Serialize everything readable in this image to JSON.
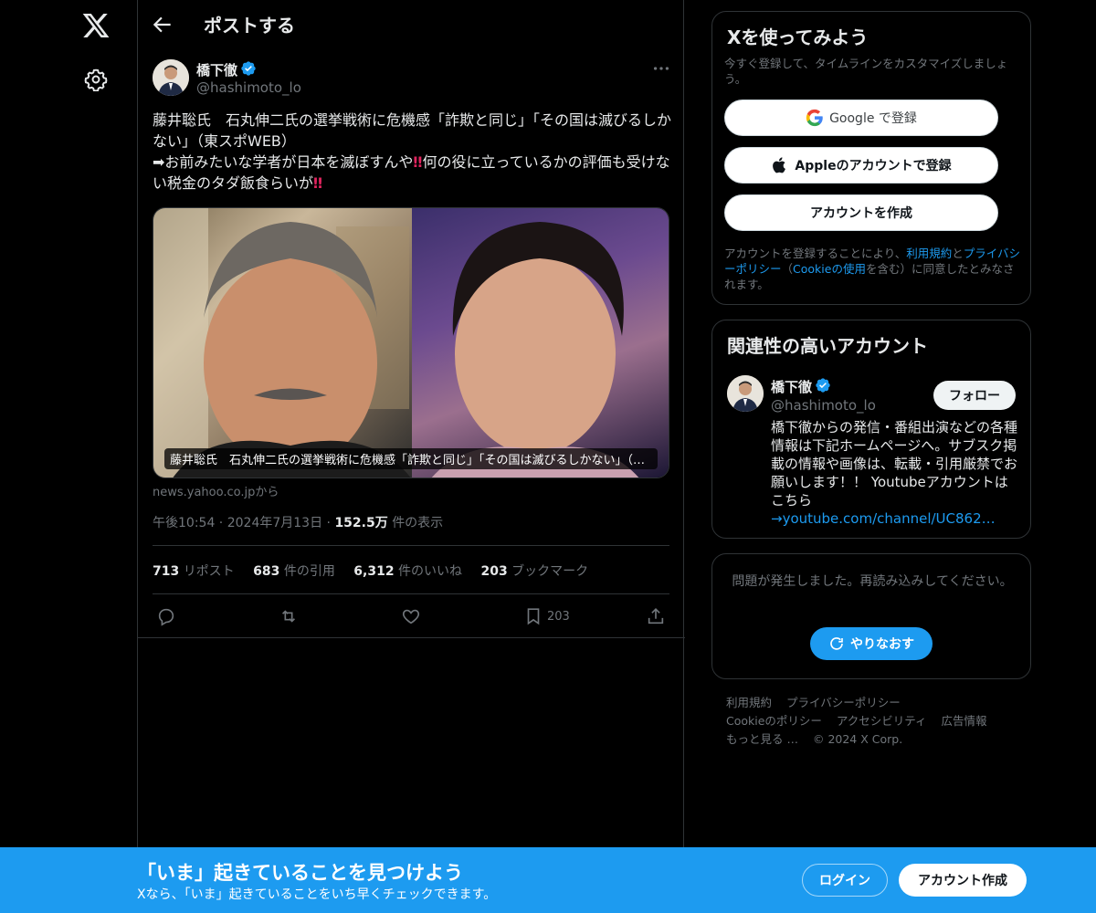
{
  "header": {
    "title": "ポストする"
  },
  "post": {
    "author_name": "橋下徹",
    "author_handle": "@hashimoto_lo",
    "text_line1": "藤井聡氏　石丸伸二氏の選挙戦術に危機感「詐欺と同じ」「その国は滅びるしかない」（東スポWEB）",
    "text_line2_pre": "➡お前みたいな学者が日本を滅ぼすんや",
    "text_bang": "‼",
    "text_line2_post": "何の役に立っているかの評価も受けない税金のタダ飯食らいが",
    "card_caption": "藤井聡氏　石丸伸二氏の選挙戦術に危機感「詐欺と同じ」「その国は滅びるしかない」（東スポWEB）",
    "card_source": "news.yahoo.co.jpから",
    "time": "午後10:54",
    "date": "2024年7月13日",
    "views_count": "152.5万",
    "views_label": "件の表示",
    "stats": {
      "reposts_num": "713",
      "reposts_label": "リポスト",
      "quotes_num": "683",
      "quotes_label": "件の引用",
      "likes_num": "6,312",
      "likes_label": "件のいいね",
      "bookmarks_num": "203",
      "bookmarks_label": "ブックマーク"
    },
    "bookmark_action_count": "203"
  },
  "signup": {
    "title": "Xを使ってみよう",
    "subtitle": "今すぐ登録して、タイムラインをカスタマイズしましょう。",
    "google_label": "Google で登録",
    "apple_label": "Appleのアカウントで登録",
    "create_label": "アカウントを作成",
    "terms_pre": "アカウントを登録することにより、",
    "terms_link1": "利用規約",
    "terms_mid1": "と",
    "terms_link2": "プライバシーポリシー",
    "terms_mid2": "（",
    "terms_link3": "Cookieの使用",
    "terms_post": "を含む）に同意したとみなされます。"
  },
  "related": {
    "title": "関連性の高いアカウント",
    "name": "橋下徹",
    "handle": "@hashimoto_lo",
    "follow_label": "フォロー",
    "bio": "橋下徹からの発信・番組出演などの各種情報は下記ホームページへ。サブスク掲載の情報や画像は、転載・引用厳禁でお願いします！！ Youtubeアカウントはこちら",
    "link": "→youtube.com/channel/UC862U…"
  },
  "error": {
    "message": "問題が発生しました。再読み込みしてください。",
    "retry_label": "やりなおす"
  },
  "footer": {
    "links": [
      "利用規約",
      "プライバシーポリシー",
      "Cookieのポリシー",
      "アクセシビリティ",
      "広告情報",
      "もっと見る …"
    ],
    "copyright": "© 2024 X Corp."
  },
  "banner": {
    "title": "「いま」起きていることを見つけよう",
    "subtitle": "Xなら、「いま」起きていることをいち早くチェックできます。",
    "login_label": "ログイン",
    "create_label": "アカウント作成"
  },
  "colors": {
    "accent": "#1d9bf0",
    "background": "#000000",
    "border": "#2f3336",
    "muted": "#71767b"
  },
  "icons": [
    "x-logo-icon",
    "gear-icon",
    "back-arrow-icon",
    "verified-badge-icon",
    "more-icon",
    "reply-icon",
    "repost-icon",
    "like-icon",
    "bookmark-icon",
    "share-icon",
    "google-icon",
    "apple-icon",
    "refresh-icon"
  ]
}
